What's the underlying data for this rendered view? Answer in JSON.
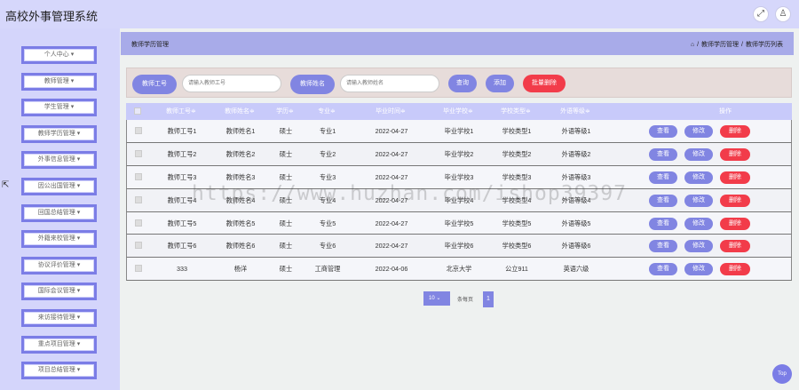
{
  "app": {
    "title": "高校外事管理系统"
  },
  "header": {
    "icons": [
      "fullscreen-icon",
      "user-icon"
    ]
  },
  "sidebar": {
    "items": [
      {
        "label": "个人中心 ▾"
      },
      {
        "label": "教师管理 ▾"
      },
      {
        "label": "学生管理 ▾"
      },
      {
        "label": "教师学历管理 ▾"
      },
      {
        "label": "外事信息管理 ▾"
      },
      {
        "label": "因公出国管理 ▾"
      },
      {
        "label": "回国总结管理 ▾"
      },
      {
        "label": "外籍来校管理 ▾"
      },
      {
        "label": "协议评价管理 ▾"
      },
      {
        "label": "国际会议管理 ▾"
      },
      {
        "label": "来访接待管理 ▾"
      },
      {
        "label": "重点项目管理 ▾"
      },
      {
        "label": "项目总结管理 ▾"
      }
    ]
  },
  "breadcrumb": {
    "title": "教师学历管理",
    "path": [
      "教师学历管理",
      "/",
      "教师学历列表"
    ],
    "separator": "/"
  },
  "search": {
    "teacher_no_label": "教师工号",
    "teacher_no_placeholder": "请输入教师工号",
    "teacher_name_label": "教师姓名",
    "teacher_name_placeholder": "请输入教师姓名",
    "query_label": "查询",
    "add_label": "添加",
    "batch_delete_label": "批量删除"
  },
  "table": {
    "headers": [
      "教师工号≑",
      "教师姓名≑",
      "学历≑",
      "专业≑",
      "毕业时间≑",
      "毕业学校≑",
      "学校类型≑",
      "外语等级≑",
      "操作"
    ],
    "rows": [
      [
        "教师工号1",
        "教师姓名1",
        "硕士",
        "专业1",
        "2022-04-27",
        "毕业学校1",
        "学校类型1",
        "外语等级1"
      ],
      [
        "教师工号2",
        "教师姓名2",
        "硕士",
        "专业2",
        "2022-04-27",
        "毕业学校2",
        "学校类型2",
        "外语等级2"
      ],
      [
        "教师工号3",
        "教师姓名3",
        "硕士",
        "专业3",
        "2022-04-27",
        "毕业学校3",
        "学校类型3",
        "外语等级3"
      ],
      [
        "教师工号4",
        "教师姓名4",
        "硕士",
        "专业4",
        "2022-04-27",
        "毕业学校4",
        "学校类型4",
        "外语等级4"
      ],
      [
        "教师工号5",
        "教师姓名5",
        "硕士",
        "专业5",
        "2022-04-27",
        "毕业学校5",
        "学校类型5",
        "外语等级5"
      ],
      [
        "教师工号6",
        "教师姓名6",
        "硕士",
        "专业6",
        "2022-04-27",
        "毕业学校6",
        "学校类型6",
        "外语等级6"
      ],
      [
        "333",
        "杨洋",
        "硕士",
        "工商管理",
        "2022-04-06",
        "北京大学",
        "公立911",
        "英语六级"
      ]
    ],
    "actions": {
      "view": "查看",
      "edit": "修改",
      "delete": "删除"
    }
  },
  "pager": {
    "page_size": "10",
    "total_text": "条每页",
    "current_page": "1"
  },
  "back_to_top": "Top",
  "watermark": "https://www.huzhan.com/ishop39397",
  "colors": {
    "accent": "#8185e2",
    "danger": "#f23c4a",
    "sidebar": "#d4d5fb",
    "topbar": "#d6d7fb"
  }
}
